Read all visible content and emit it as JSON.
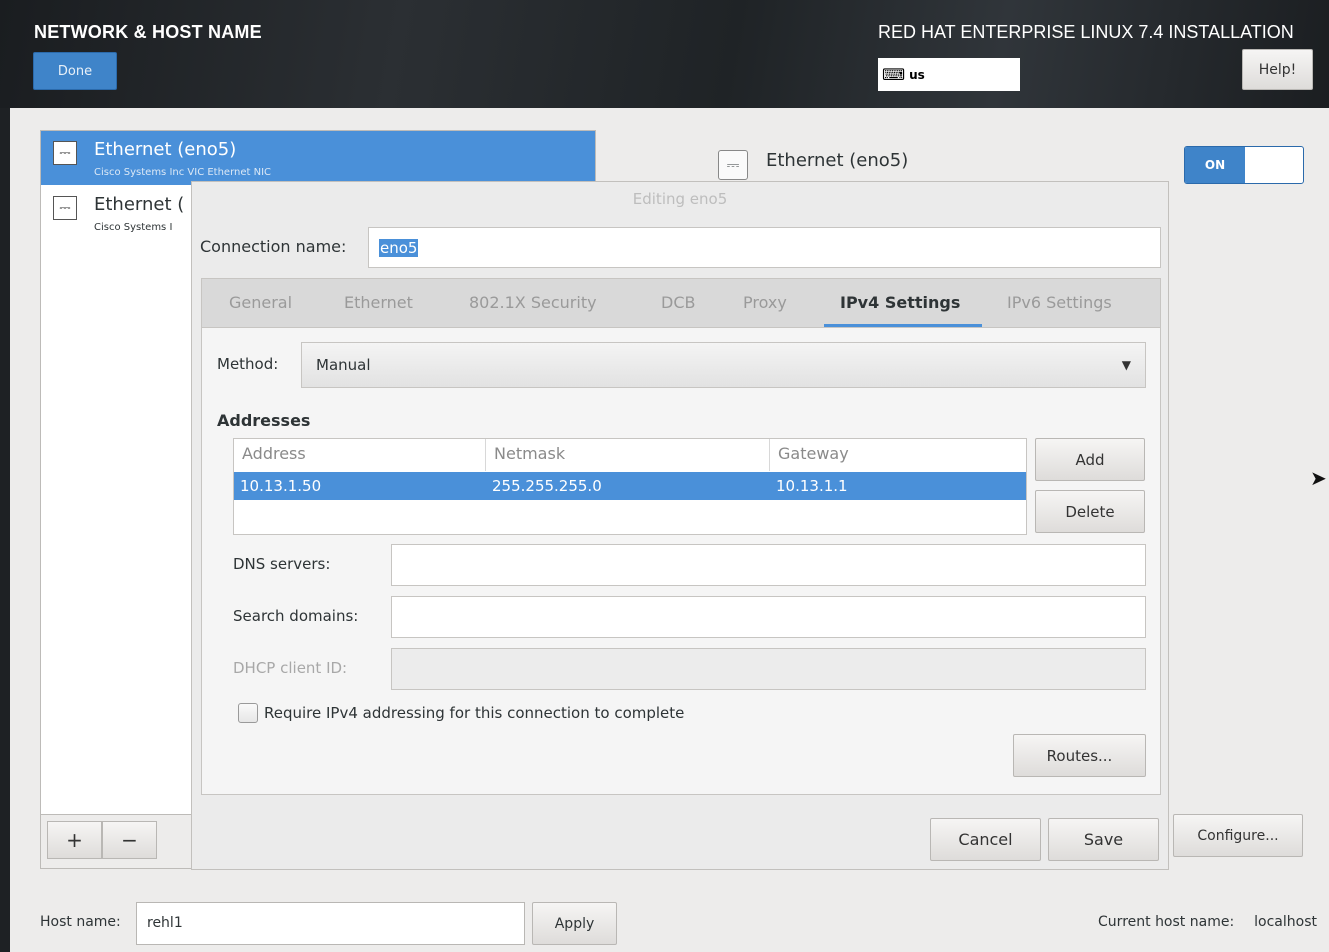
{
  "header": {
    "title": "NETWORK & HOST NAME",
    "done_label": "Done",
    "product_title": "RED HAT ENTERPRISE LINUX 7.4 INSTALLATION",
    "keyboard_layout": "us",
    "help_label": "Help!"
  },
  "devices": [
    {
      "name": "Ethernet (eno5)",
      "description": "Cisco Systems Inc VIC Ethernet NIC",
      "selected": true
    },
    {
      "name": "Ethernet (",
      "description": "Cisco Systems I",
      "selected": false
    }
  ],
  "list_controls": {
    "add": "+",
    "remove": "−"
  },
  "detail": {
    "device_name": "Ethernet (eno5)",
    "toggle_state": "ON",
    "configure_label": "Configure..."
  },
  "host": {
    "label": "Host name:",
    "value": "rehl1",
    "apply_label": "Apply",
    "current_label": "Current host name:",
    "current_value": "localhost"
  },
  "dialog": {
    "title": "Editing eno5",
    "connection_name_label": "Connection name:",
    "connection_name_value": "eno5",
    "tabs": [
      "General",
      "Ethernet",
      "802.1X Security",
      "DCB",
      "Proxy",
      "IPv4 Settings",
      "IPv6 Settings"
    ],
    "active_tab": "IPv4 Settings",
    "method_label": "Method:",
    "method_value": "Manual",
    "addresses_label": "Addresses",
    "columns": [
      "Address",
      "Netmask",
      "Gateway"
    ],
    "rows": [
      {
        "address": "10.13.1.50",
        "netmask": "255.255.255.0",
        "gateway": "10.13.1.1"
      }
    ],
    "add_label": "Add",
    "delete_label": "Delete",
    "dns_label": "DNS servers:",
    "dns_value": "",
    "search_label": "Search domains:",
    "search_value": "",
    "dhcp_label": "DHCP client ID:",
    "dhcp_value": "",
    "require_label": "Require IPv4 addressing for this connection to complete",
    "require_checked": false,
    "routes_label": "Routes...",
    "cancel_label": "Cancel",
    "save_label": "Save"
  },
  "colors": {
    "accent": "#4a90d9",
    "header_bg": "#24282c",
    "window_bg": "#edeceb"
  }
}
